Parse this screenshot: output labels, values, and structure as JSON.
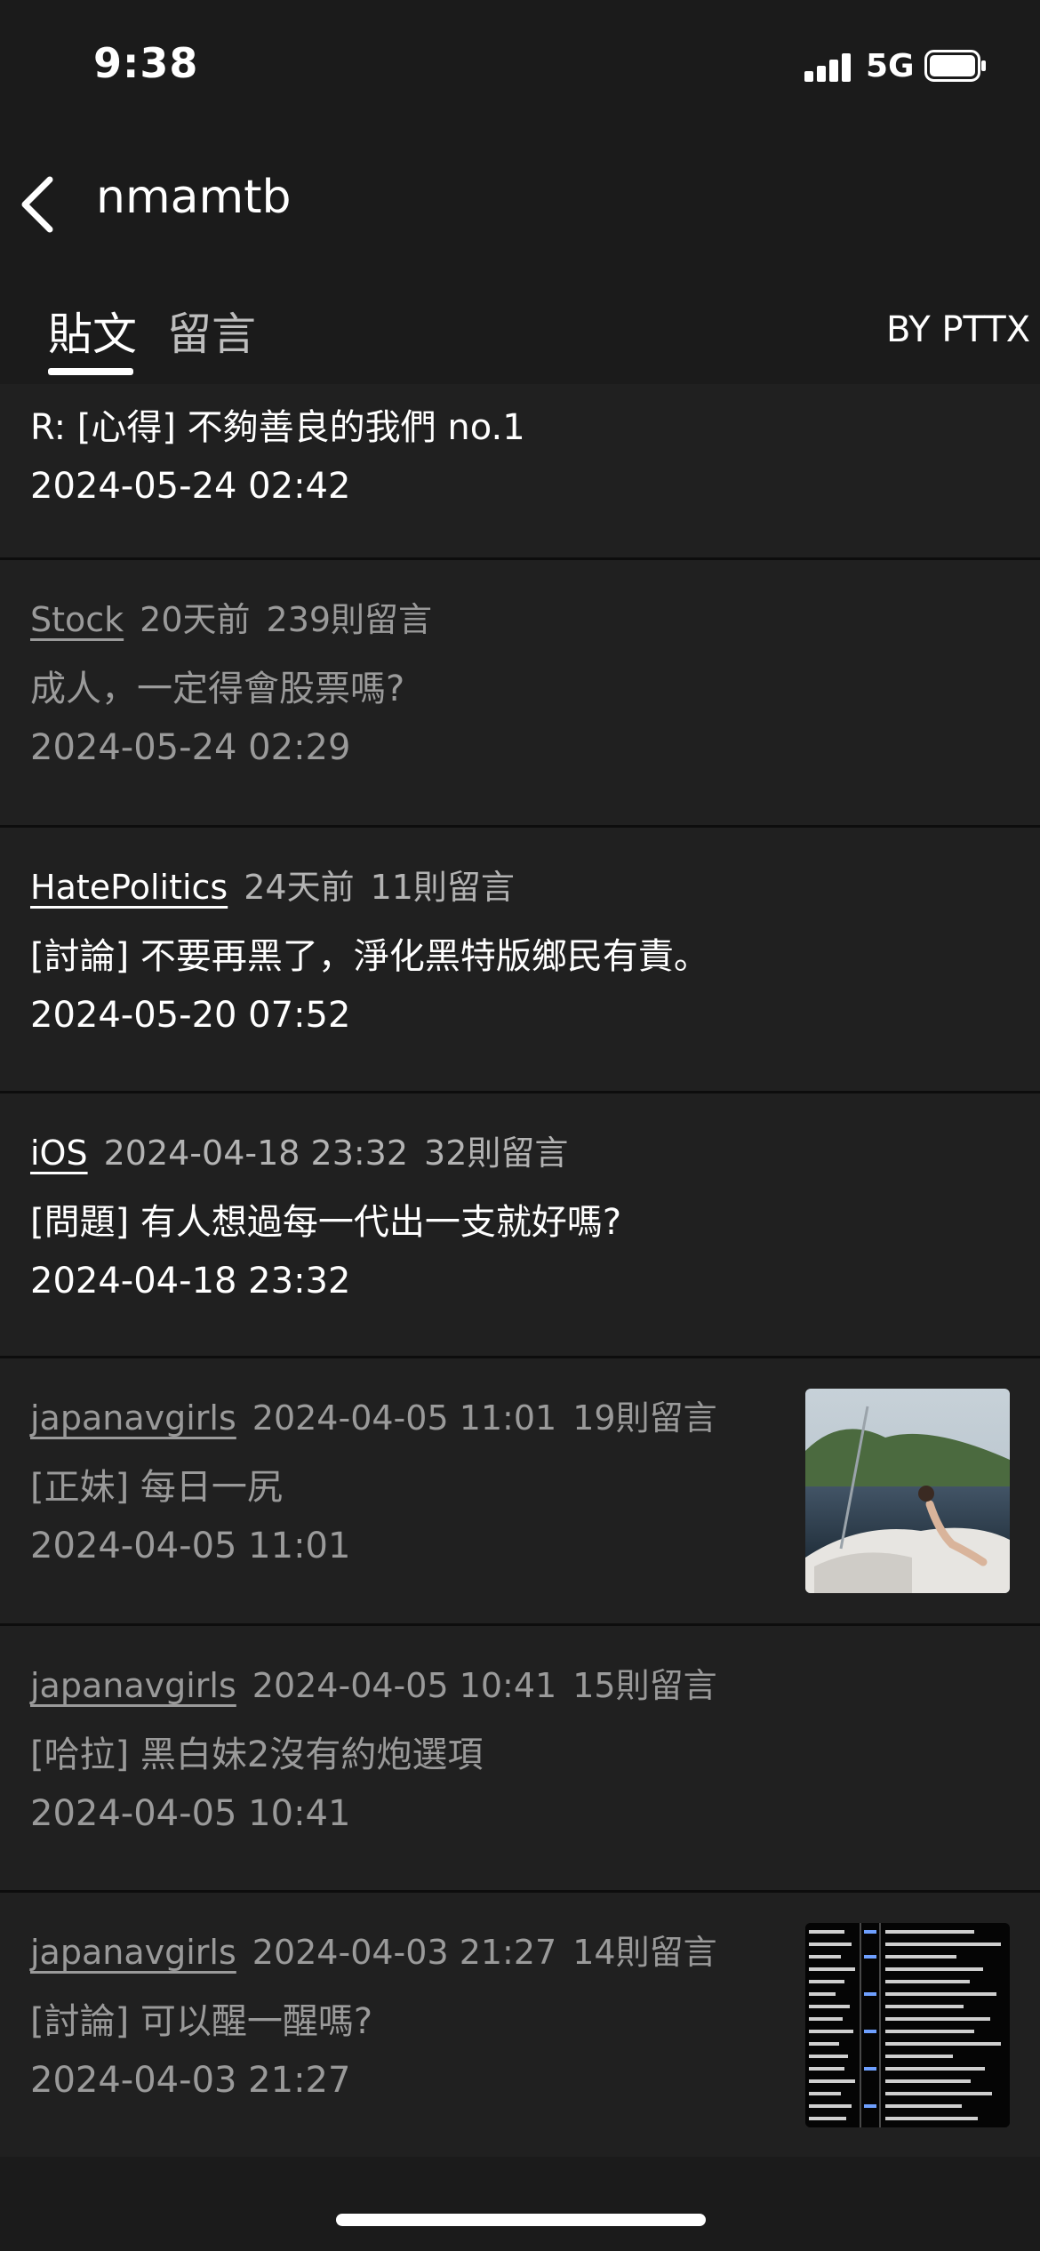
{
  "status": {
    "time": "9:38",
    "network": "5G"
  },
  "nav": {
    "title": "nmamtb"
  },
  "tabs": [
    {
      "label": "貼文"
    },
    {
      "label": "留言"
    }
  ],
  "byline": "BY PTTX",
  "posts": [
    {
      "title": "R: [心得] 不夠善良的我們 no.1",
      "date": "2024-05-24 02:42"
    },
    {
      "board": "Stock",
      "when": "20天前",
      "comments": "239則留言",
      "title": "成人，一定得會股票嗎?",
      "date": "2024-05-24 02:29"
    },
    {
      "board": "HatePolitics",
      "when": "24天前",
      "comments": "11則留言",
      "title": "[討論] 不要再黑了，淨化黑特版鄉民有責。",
      "date": "2024-05-20 07:52"
    },
    {
      "board": "iOS",
      "when": "2024-04-18 23:32",
      "comments": "32則留言",
      "title": "[問題] 有人想過每一代出一支就好嗎?",
      "date": "2024-04-18 23:32"
    },
    {
      "board": "japanavgirls",
      "when": "2024-04-05 11:01",
      "comments": "19則留言",
      "title": "[正妹] 每日一尻",
      "date": "2024-04-05 11:01"
    },
    {
      "board": "japanavgirls",
      "when": "2024-04-05 10:41",
      "comments": "15則留言",
      "title": "[哈拉] 黑白妹2沒有約炮選項",
      "date": "2024-04-05 10:41"
    },
    {
      "board": "japanavgirls",
      "when": "2024-04-03 21:27",
      "comments": "14則留言",
      "title": "[討論] 可以醒一醒嗎?",
      "date": "2024-04-03 21:27"
    }
  ]
}
